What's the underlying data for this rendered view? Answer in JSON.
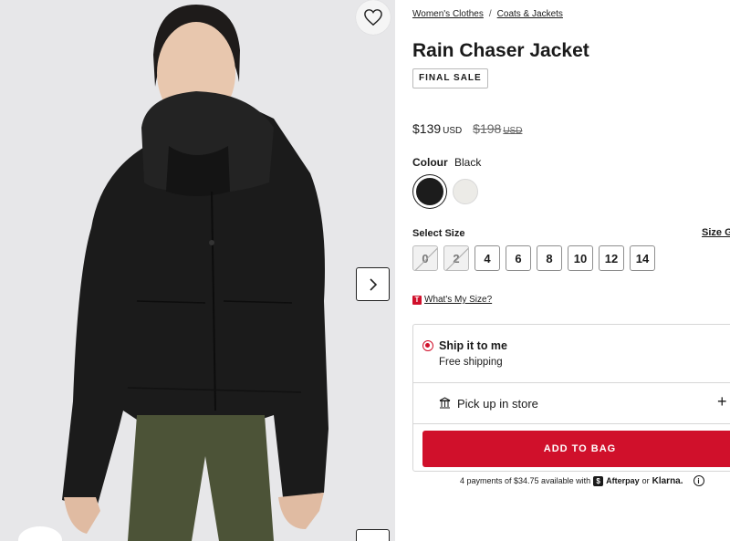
{
  "gallery": {
    "wishlist_icon": "heart-icon",
    "next_icon": "chevron-right-icon"
  },
  "breadcrumb": {
    "items": [
      "Women's Clothes",
      "Coats & Jackets"
    ],
    "separator": "/"
  },
  "product": {
    "title": "Rain Chaser Jacket",
    "badge": "FINAL SALE",
    "price": "$139",
    "price_currency": "USD",
    "was_price": "$198",
    "was_currency": "USD"
  },
  "colour": {
    "label": "Colour",
    "selected": "Black",
    "swatches": [
      {
        "name": "Black",
        "hex": "#1c1c1c"
      },
      {
        "name": "White",
        "hex": "#ecebe7"
      }
    ]
  },
  "size": {
    "label": "Select Size",
    "guide_label": "Size Guide",
    "options": [
      {
        "label": "0",
        "available": false
      },
      {
        "label": "2",
        "available": false
      },
      {
        "label": "4",
        "available": true
      },
      {
        "label": "6",
        "available": true
      },
      {
        "label": "8",
        "available": true
      },
      {
        "label": "10",
        "available": true
      },
      {
        "label": "12",
        "available": true
      },
      {
        "label": "14",
        "available": true
      }
    ],
    "whats_my_size": "What's My Size?",
    "whats_my_size_icon": "T"
  },
  "delivery": {
    "ship_title": "Ship it to me",
    "ship_subtitle": "Free shipping",
    "pickup_label": "Pick up in store",
    "expand_symbol": "+"
  },
  "cta": {
    "add_to_bag": "ADD TO BAG"
  },
  "payments": {
    "prefix": "4 payments of $34.75 available with",
    "afterpay_icon_text": "$",
    "afterpay": "Afterpay",
    "or": "or",
    "klarna": "Klarna.",
    "info": "i"
  },
  "colors": {
    "accent": "#d0102b",
    "text": "#1a1a1a",
    "gallery_bg": "#e6e6e8"
  }
}
